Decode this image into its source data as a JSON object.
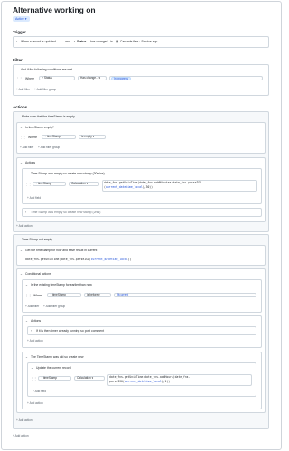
{
  "header": {
    "title": "Alternative working on",
    "status": "Active"
  },
  "trigger": {
    "label": "Trigger",
    "when": "When a record is updated",
    "and": "and",
    "field": "Status",
    "has_changed": "has changed",
    "in": "in",
    "table": "Cascade files · Service app"
  },
  "filter": {
    "label": "Filter",
    "rule": "And if the following conditions are met",
    "where": "Where",
    "field": "Status",
    "op": "Has change...",
    "value": "In progress",
    "add_filter": "+ Add filter",
    "add_group": "+ Add filter group"
  },
  "actions": {
    "label": "Actions",
    "b1": {
      "title": "Make sure that the timeStamp is empty",
      "cond": "Is timeStamp empty?",
      "where": "Where",
      "field": "timeStamp",
      "op": "is empty",
      "add_filter": "+ Add filter",
      "add_group": "+ Add filter group",
      "actions_label": "Actions",
      "a1_title": "Time Stamp was empty so create new stamp (30mins)",
      "a1_field": "timeStamp",
      "a1_type": "Calculation",
      "a1_code1": "date_fns.getUnixTime(date_fns.addMinutes(date_fns.parseISO",
      "a1_code2": "(",
      "a1_code2v": "current_datetime_local",
      "a1_code2e": "),30))",
      "a1_add_field": "+ Add field",
      "a2_title": "Time Stamp was empty so create new stamp (2hrs)",
      "add_action": "+ Add action"
    },
    "b2": {
      "title": "Time Stamp not empty",
      "get_title": "Get the timeStamp for now and save result in current",
      "get_code": "date_fns.getUnixTime(date_fns.parseISO(",
      "get_code_v": "current_datetime_local",
      "get_code_e": "))",
      "cond_actions": "Conditional actions",
      "c_title": "Is the existing timeStamp for earlier than now",
      "c_where": "Where",
      "c_field": "timeStamp",
      "c_op": "is before",
      "c_value": "@current",
      "c_add_filter": "+ Add filter",
      "c_add_group": "+ Add filter group",
      "c_actions": "Actions",
      "c_action1": "If it is then timer already running so post comment",
      "c_add_action": "+ Add action",
      "old_title": "The TimeStamp was old so create new",
      "old_update": "Update the current record",
      "old_field": "timeStamp",
      "old_type": "Calculation",
      "old_code1": "date_fns.getUnixTime(date_fns.addHours(date_fns.",
      "old_code2": "parseISO(",
      "old_code2v": "current_datetime_local",
      "old_code2e": "),1))",
      "old_add_field": "+ Add field",
      "old_add_action": "+ Add action",
      "add_action": "+ Add action"
    },
    "add_action": "+ Add action"
  }
}
